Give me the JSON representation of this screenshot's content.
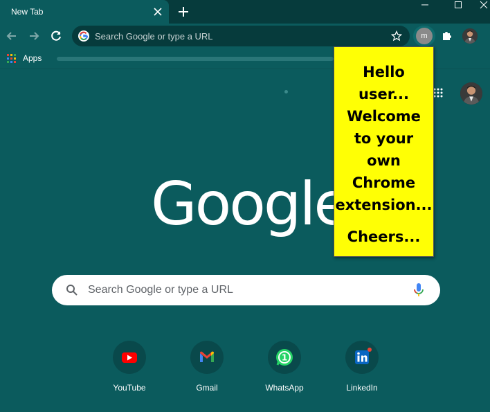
{
  "tab": {
    "title": "New Tab"
  },
  "omnibox": {
    "placeholder": "Search Google or type a URL"
  },
  "extension": {
    "initial": "m"
  },
  "bookmarks": {
    "apps_label": "Apps"
  },
  "page": {
    "logo": "Google",
    "search_placeholder": "Search Google or type a URL"
  },
  "shortcuts": [
    {
      "label": "YouTube",
      "icon": "youtube-icon"
    },
    {
      "label": "Gmail",
      "icon": "gmail-icon"
    },
    {
      "label": "WhatsApp",
      "icon": "whatsapp-icon"
    },
    {
      "label": "LinkedIn",
      "icon": "linkedin-icon"
    }
  ],
  "popup": {
    "message_lines": [
      "Hello",
      "user...",
      "Welcome",
      "to your",
      "own",
      "Chrome",
      "extension..."
    ],
    "closing": "Cheers..."
  },
  "colors": {
    "theme_bg": "#0b5b5d",
    "titlebar": "#063b3c",
    "popup_bg": "#ffff05"
  }
}
